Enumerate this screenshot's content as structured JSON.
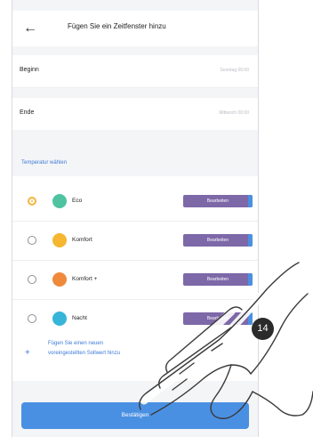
{
  "header": {
    "back_icon": "arrow-left-icon",
    "title": "Fügen Sie ein Zeitfenster hinzu"
  },
  "rows": [
    {
      "label": "Beginn",
      "value": "Sonntag 00:00"
    },
    {
      "label": "Ende",
      "value": "Mittwoch 00:00"
    }
  ],
  "section": {
    "title": "Temperatur wählen"
  },
  "temperatures": [
    {
      "label": "Eco",
      "action": "Bearbeiten",
      "selected": true,
      "color": "#4fc3a1"
    },
    {
      "label": "Komfort",
      "action": "Bearbeiten",
      "selected": false,
      "color": "#f5b631"
    },
    {
      "label": "Komfort +",
      "action": "Bearbeiten",
      "selected": false,
      "color": "#ef8a3d"
    },
    {
      "label": "Nacht",
      "action": "Bearbeiten",
      "selected": false,
      "color": "#37b5d8"
    }
  ],
  "add": {
    "icon": "plus-icon",
    "line1": "Fügen Sie einen neuen",
    "line2": "voreingestellten Sollwert hinzu"
  },
  "confirm_label": "Bestätigen",
  "step_number": "14",
  "colors": {
    "accent": "#4a90e2",
    "pill": "#7d68a8",
    "radio_selected": "#f6b53f"
  }
}
